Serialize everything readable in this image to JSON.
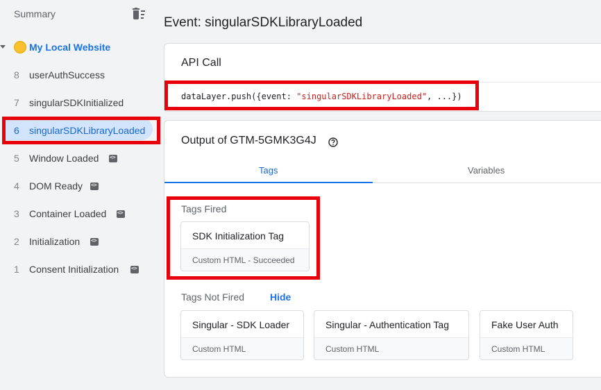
{
  "sidebar": {
    "summary_label": "Summary",
    "site_label": "My Local Website",
    "items": [
      {
        "num": "8",
        "label": "userAuthSuccess",
        "has_code": false
      },
      {
        "num": "7",
        "label": "singularSDKInitialized",
        "has_code": false
      },
      {
        "num": "6",
        "label": "singularSDKLibraryLoaded",
        "has_code": false,
        "active": true
      },
      {
        "num": "5",
        "label": "Window Loaded",
        "has_code": true
      },
      {
        "num": "4",
        "label": "DOM Ready",
        "has_code": true
      },
      {
        "num": "3",
        "label": "Container Loaded",
        "has_code": true
      },
      {
        "num": "2",
        "label": "Initialization",
        "has_code": true
      },
      {
        "num": "1",
        "label": "Consent Initialization",
        "has_code": true
      }
    ]
  },
  "main": {
    "title": "Event: singularSDKLibraryLoaded",
    "api_call": {
      "heading": "API Call",
      "code_prefix": "dataLayer.push({event: ",
      "code_string": "\"singularSDKLibraryLoaded\"",
      "code_suffix": ", ...})"
    },
    "output": {
      "heading": "Output of GTM-5GMK3G4J",
      "tabs": [
        "Tags",
        "Variables"
      ],
      "active_tab": "Tags",
      "tags_fired_label": "Tags Fired",
      "tags_fired": [
        {
          "name": "SDK Initialization Tag",
          "sub": "Custom HTML - Succeeded"
        }
      ],
      "tags_not_fired_label": "Tags Not Fired",
      "hide_label": "Hide",
      "tags_not_fired": [
        {
          "name": "Singular - SDK Loader",
          "sub": "Custom HTML"
        },
        {
          "name": "Singular - Authentication Tag",
          "sub": "Custom HTML"
        },
        {
          "name": "Fake User Auth",
          "sub": "Custom HTML"
        }
      ]
    }
  },
  "colors": {
    "accent": "#1a73e8",
    "highlight_red": "#e8000b",
    "active_pill": "#d2e3fc"
  }
}
